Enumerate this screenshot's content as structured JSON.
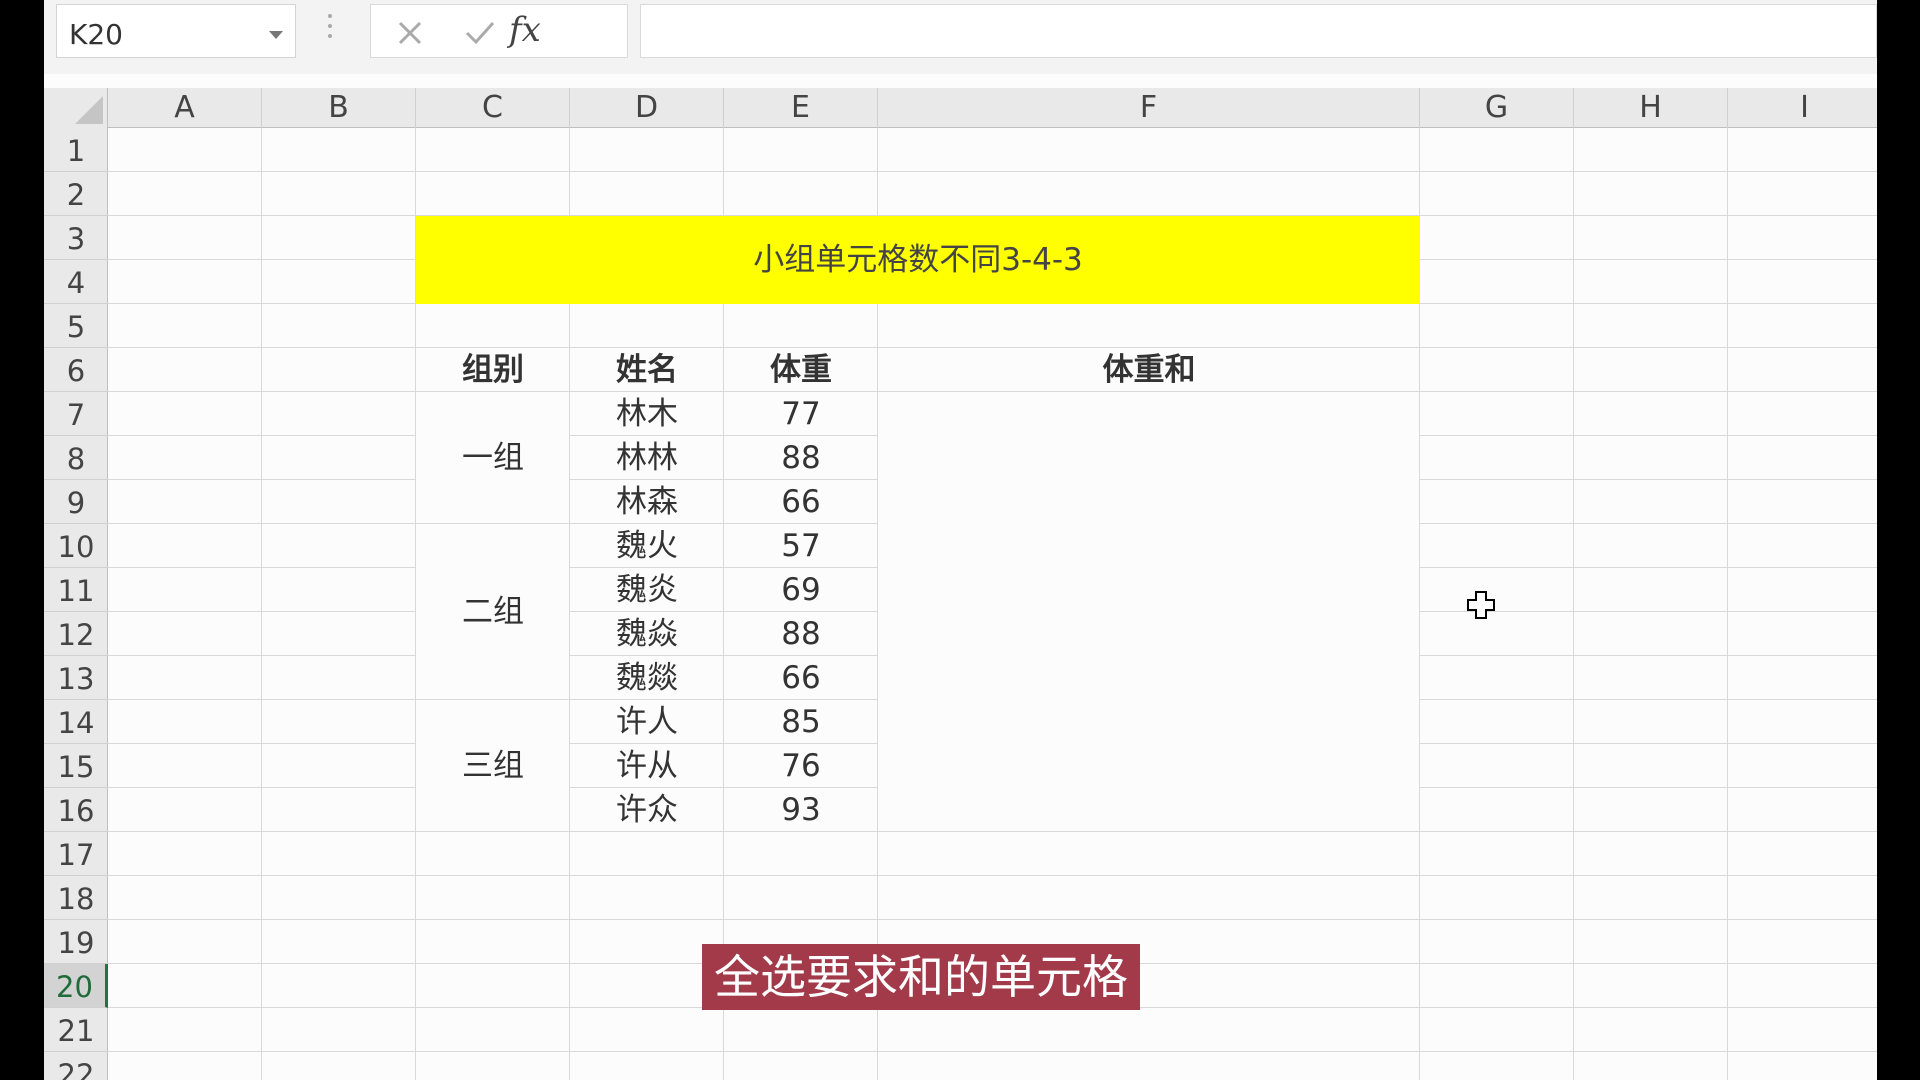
{
  "formula_bar": {
    "name_box": "K20",
    "cancel_icon": "close-icon",
    "enter_icon": "check-icon",
    "fx_label": "fx",
    "formula": ""
  },
  "columns": [
    "A",
    "B",
    "C",
    "D",
    "E",
    "F",
    "G",
    "H",
    "I"
  ],
  "rows": [
    "1",
    "2",
    "3",
    "4",
    "5",
    "6",
    "7",
    "8",
    "9",
    "10",
    "11",
    "12",
    "13",
    "14",
    "15",
    "16",
    "17",
    "18",
    "19",
    "20",
    "21",
    "22"
  ],
  "selected_row": "20",
  "sheet": {
    "title": "小组单元格数不同3-4-3",
    "headers": {
      "group": "组别",
      "name": "姓名",
      "weight": "体重",
      "sum": "体重和"
    },
    "groups": [
      {
        "label": "一组",
        "members": [
          {
            "name": "林木",
            "weight": "77"
          },
          {
            "name": "林林",
            "weight": "88"
          },
          {
            "name": "林森",
            "weight": "66"
          }
        ]
      },
      {
        "label": "二组",
        "members": [
          {
            "name": "魏火",
            "weight": "57"
          },
          {
            "name": "魏炎",
            "weight": "69"
          },
          {
            "name": "魏焱",
            "weight": "88"
          },
          {
            "name": "魏燚",
            "weight": "66"
          }
        ]
      },
      {
        "label": "三组",
        "members": [
          {
            "name": "许人",
            "weight": "85"
          },
          {
            "name": "许从",
            "weight": "76"
          },
          {
            "name": "许众",
            "weight": "93"
          }
        ]
      }
    ]
  },
  "caption": "全选要求和的单元格",
  "cursor_icon": "cell-select-cross-icon"
}
